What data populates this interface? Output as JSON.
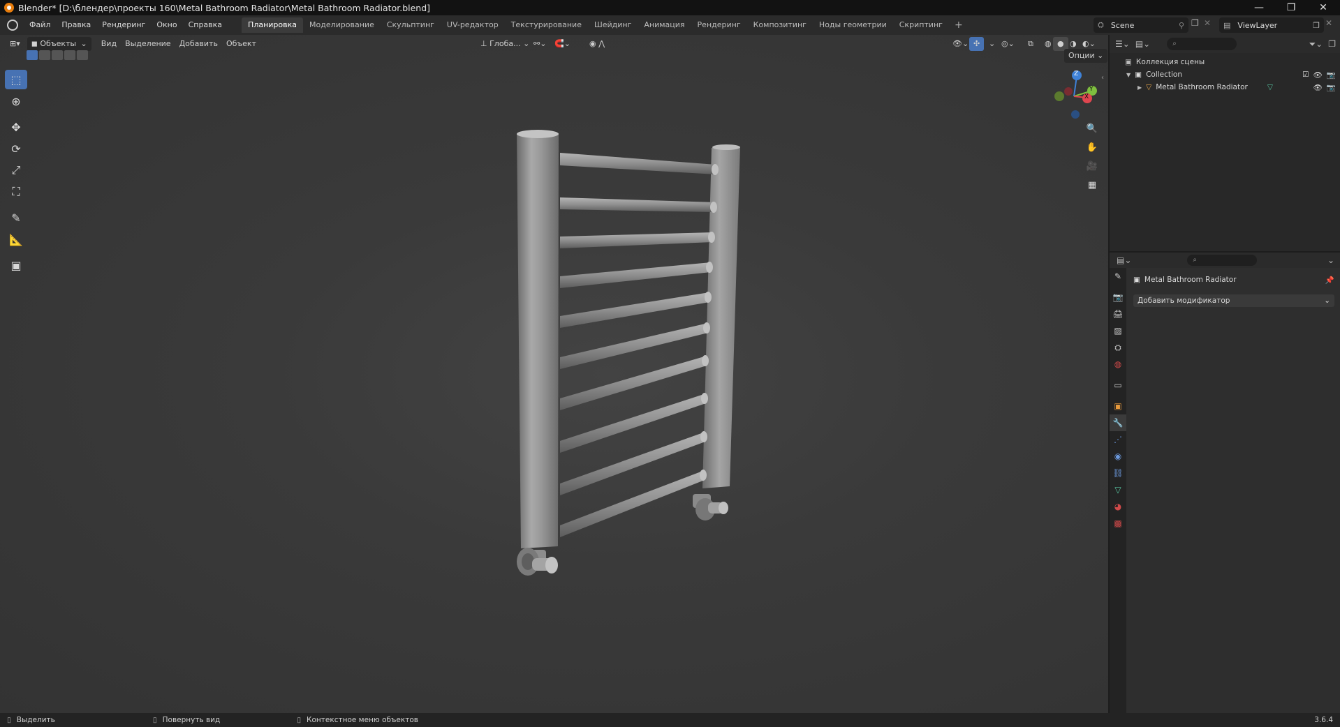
{
  "window": {
    "title": "Blender* [D:\\блендер\\проекты 160\\Metal Bathroom Radiator\\Metal Bathroom Radiator.blend]",
    "minimize": "—",
    "restore": "❐",
    "close": "✕"
  },
  "menu": {
    "items": [
      "Файл",
      "Правка",
      "Рендеринг",
      "Окно",
      "Справка"
    ]
  },
  "workspaces": {
    "tabs": [
      "Планировка",
      "Моделирование",
      "Скульптинг",
      "UV-редактор",
      "Текстурирование",
      "Шейдинг",
      "Анимация",
      "Рендеринг",
      "Композитинг",
      "Ноды геометрии",
      "Скриптинг"
    ],
    "active_index": 0,
    "add": "+"
  },
  "scene": {
    "name": "Scene",
    "viewlayer": "ViewLayer"
  },
  "viewport_header": {
    "mode": "Объекты",
    "menus": [
      "Вид",
      "Выделение",
      "Добавить",
      "Объект"
    ],
    "orientation": "Глоба...",
    "options": "Опции"
  },
  "gizmo": {
    "z": "Z",
    "y": "Y",
    "x": "X"
  },
  "outliner": {
    "scene_collection": "Коллекция сцены",
    "collection": "Collection",
    "object": "Metal Bathroom Radiator"
  },
  "properties": {
    "object_name": "Metal Bathroom Radiator",
    "add_modifier": "Добавить модификатор"
  },
  "status": {
    "select": "Выделить",
    "rotate": "Повернуть вид",
    "context": "Контекстное меню объектов",
    "version": "3.6.4"
  },
  "colors": {
    "active_tool": "#4772b3",
    "axis_x": "#e0464f",
    "axis_y": "#7fbf3f",
    "axis_z": "#3f82d8",
    "accent_orange": "#e87d0d"
  }
}
